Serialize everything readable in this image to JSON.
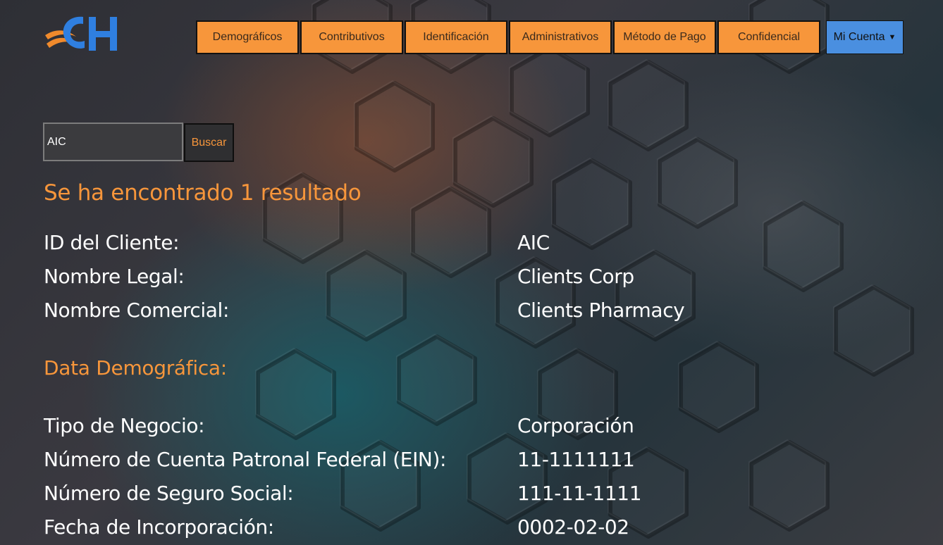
{
  "header": {
    "logo_text": "CH",
    "nav": [
      {
        "label": "Demográficos"
      },
      {
        "label": "Contributivos"
      },
      {
        "label": "Identificación"
      },
      {
        "label": "Administrativos"
      },
      {
        "label": "Método de Pago"
      },
      {
        "label": "Confidencial"
      }
    ],
    "account": {
      "label": "Mi Cuenta",
      "icon": "chevron-down-icon"
    }
  },
  "search": {
    "value": "AIC",
    "button_label": "Buscar"
  },
  "result_title": "Se ha encontrado 1 resultado",
  "client": [
    {
      "label": "ID del Cliente:",
      "value": "AIC"
    },
    {
      "label": "Nombre Legal:",
      "value": "Clients Corp"
    },
    {
      "label": "Nombre Comercial:",
      "value": "Clients Pharmacy"
    }
  ],
  "demographic": {
    "title": "Data Demográfica:",
    "rows": [
      {
        "label": "Tipo de Negocio:",
        "value": "Corporación"
      },
      {
        "label": "Número de Cuenta Patronal Federal (EIN):",
        "value": "11-1111111"
      },
      {
        "label": "Número de Seguro Social:",
        "value": "111-11-1111"
      },
      {
        "label": "Fecha de Incorporación:",
        "value": "0002-02-02"
      }
    ]
  },
  "colors": {
    "accent": "#f7963b",
    "account_button": "#4a8fe0",
    "text": "#ffffff"
  }
}
